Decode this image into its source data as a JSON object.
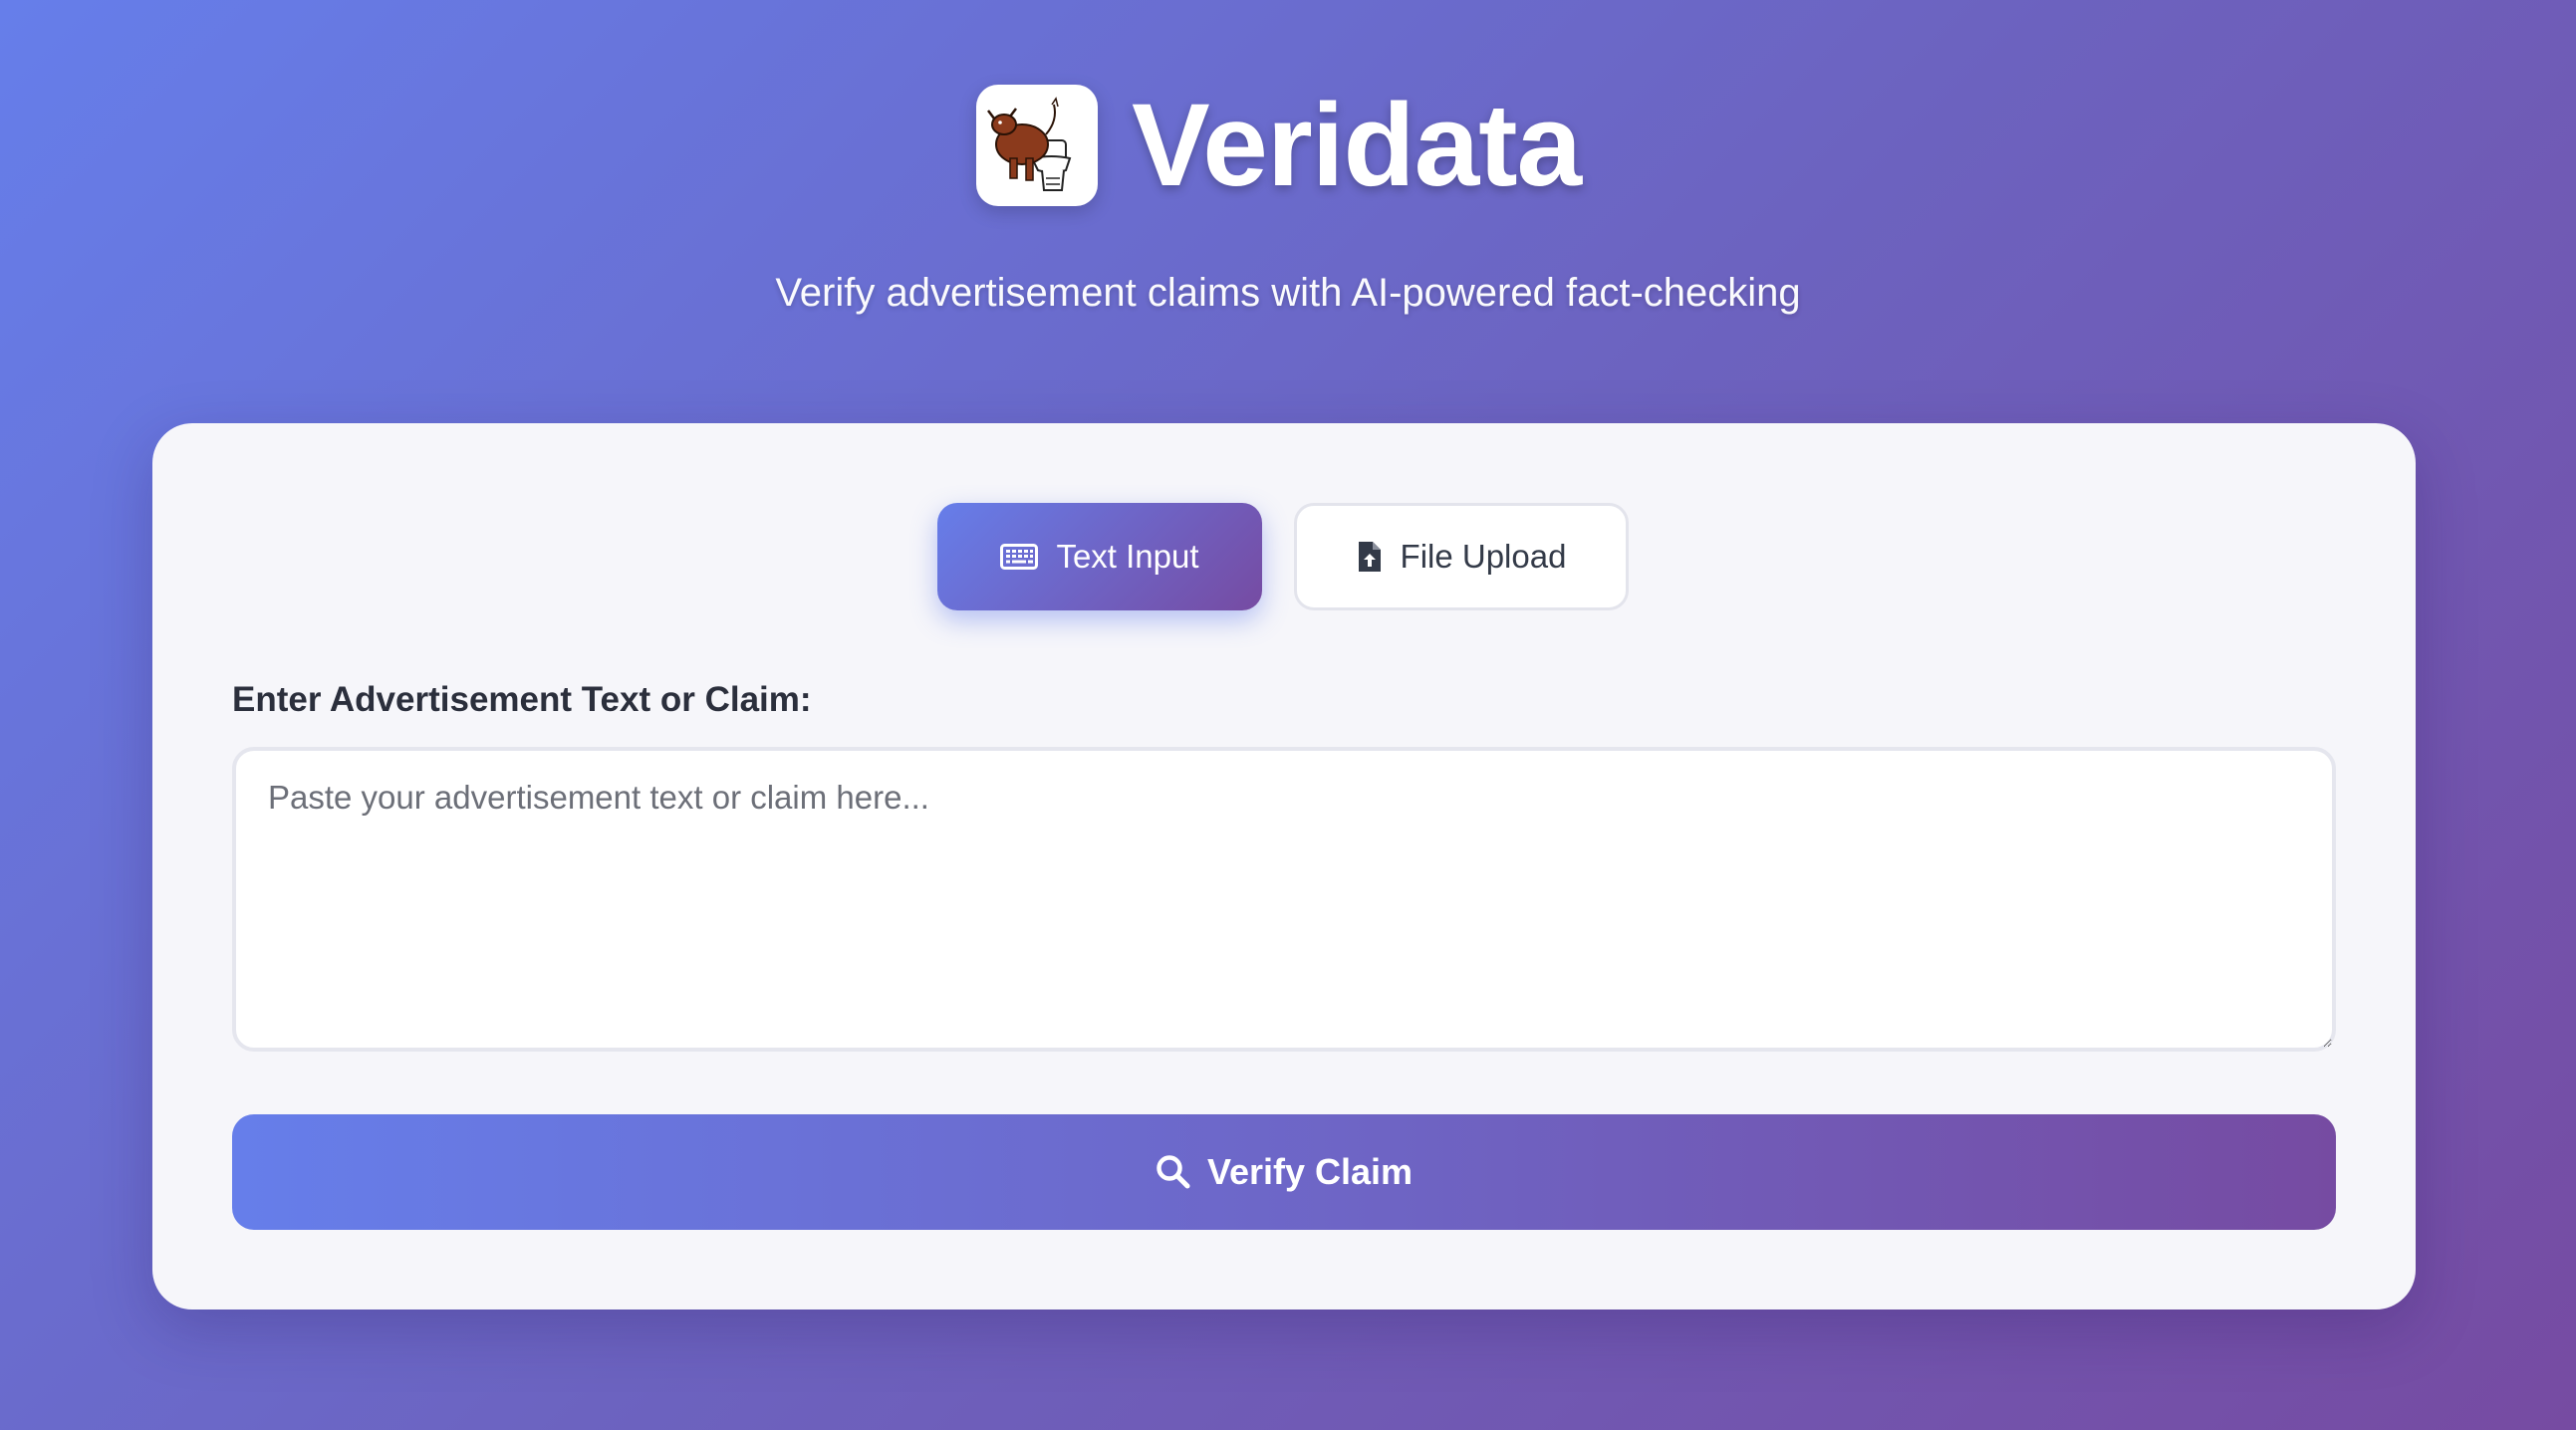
{
  "header": {
    "brand_name": "Veridata",
    "logo_icon": "cartoon-bull-on-toilet-logo",
    "subtitle": "Verify advertisement claims with AI-powered fact-checking"
  },
  "tabs": [
    {
      "label": "Text Input",
      "icon": "keyboard-icon",
      "active": true
    },
    {
      "label": "File Upload",
      "icon": "file-upload-icon",
      "active": false
    }
  ],
  "form": {
    "label": "Enter Advertisement Text or Claim:",
    "placeholder": "Paste your advertisement text or claim here...",
    "value": ""
  },
  "verify_button": {
    "label": "Verify Claim",
    "icon": "search-icon"
  },
  "colors": {
    "gradient_start": "#667eea",
    "gradient_end": "#764ba2",
    "card_bg": "#f6f6fa"
  }
}
